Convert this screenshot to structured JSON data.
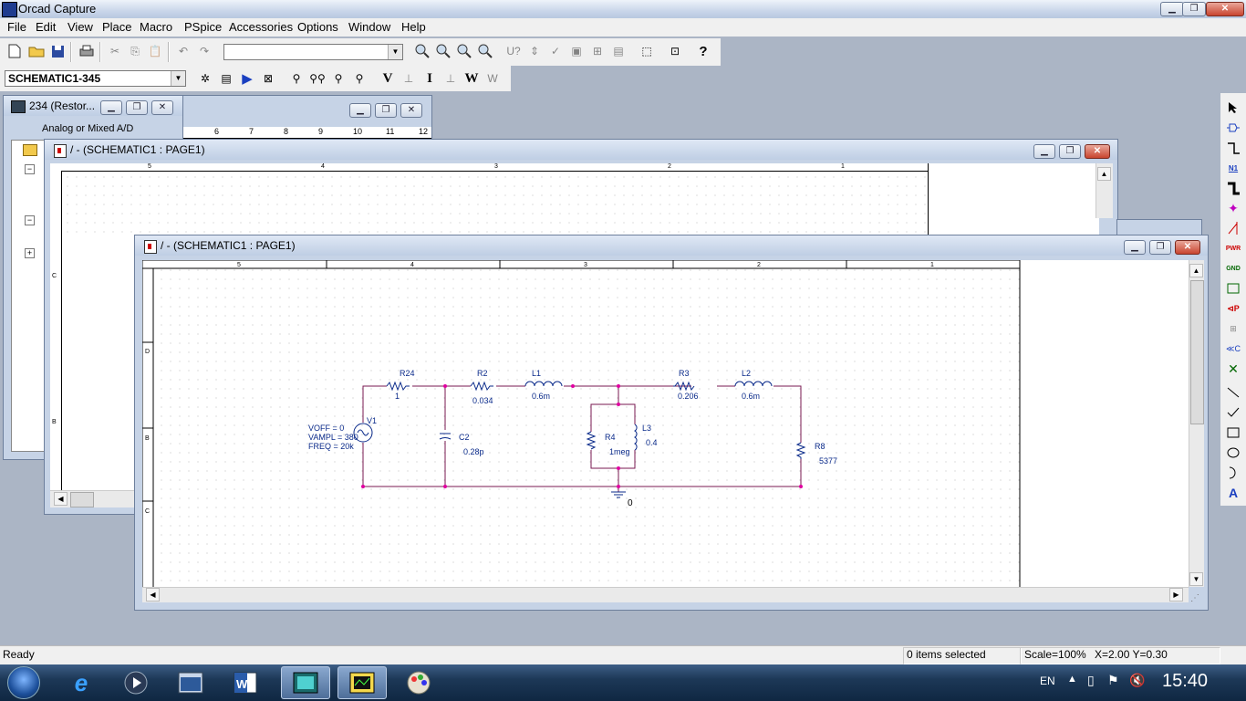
{
  "app": {
    "title": "Orcad Capture"
  },
  "menu": [
    "File",
    "Edit",
    "View",
    "Place",
    "Macro",
    "PSpice",
    "Accessories",
    "Options",
    "Window",
    "Help"
  ],
  "toolbar": {
    "zoom_combo_value": "",
    "schematic_combo_value": "SCHEMATIC1-345"
  },
  "project_window": {
    "title": "234 (Restor...",
    "tab_label": "Analog or Mixed A/D"
  },
  "ruler_behind": [
    "6",
    "7",
    "8",
    "9",
    "10",
    "11",
    "12"
  ],
  "back_window": {
    "title": "/ - (SCHEMATIC1 : PAGE1)",
    "ruler": [
      "5",
      "4",
      "3",
      "2",
      "1"
    ],
    "row_labels": [
      "C",
      "B"
    ]
  },
  "front_window": {
    "title": "/ - (SCHEMATIC1 : PAGE1)",
    "ruler": [
      "5",
      "4",
      "3",
      "2",
      "1"
    ],
    "row_labels": [
      "D",
      "B",
      "C"
    ]
  },
  "schematic": {
    "source": {
      "ref": "V1",
      "params": [
        "VOFF = 0",
        "VAMPL = 380",
        "FREQ = 20k"
      ]
    },
    "components": [
      {
        "ref": "R24",
        "value": "1"
      },
      {
        "ref": "R2",
        "value": "0.034"
      },
      {
        "ref": "L1",
        "value": "0.6m"
      },
      {
        "ref": "R3",
        "value": "0.206"
      },
      {
        "ref": "L2",
        "value": "0.6m"
      },
      {
        "ref": "C2",
        "value": "0.28p"
      },
      {
        "ref": "R4",
        "value": "1meg"
      },
      {
        "ref": "L3",
        "value": "0.4"
      },
      {
        "ref": "R8",
        "value": "5377"
      }
    ],
    "ground_label": "0"
  },
  "status": {
    "ready": "Ready",
    "selection": "0 items selected",
    "scale": "Scale=100%",
    "coords": "X=2.00  Y=0.30"
  },
  "taskbar": {
    "language": "EN",
    "clock": "15:40"
  },
  "colors": {
    "wire": "#7a1850",
    "junction": "#e000a0",
    "part": "#0a2a8a",
    "titlebar": "#c9d6ea"
  }
}
